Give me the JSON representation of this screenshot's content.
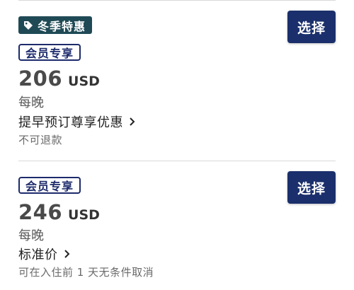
{
  "colors": {
    "accent_button": "#1a2f6b",
    "promo_tag_bg": "#1f4a55",
    "member_badge": "#1d2b6b"
  },
  "offers": [
    {
      "promo_tag": {
        "label": "冬季特惠",
        "icon": "tag-icon"
      },
      "member_badge": "会员专享",
      "price": {
        "amount": "206",
        "currency": "USD"
      },
      "per_night": "每晚",
      "rate_name": "提早预订尊享优惠",
      "policy": "不可退款",
      "select_label": "选择"
    },
    {
      "member_badge": "会员专享",
      "price": {
        "amount": "246",
        "currency": "USD"
      },
      "per_night": "每晚",
      "rate_name": "标准价",
      "policy": "可在入住前 1 天无条件取消",
      "select_label": "选择"
    }
  ]
}
